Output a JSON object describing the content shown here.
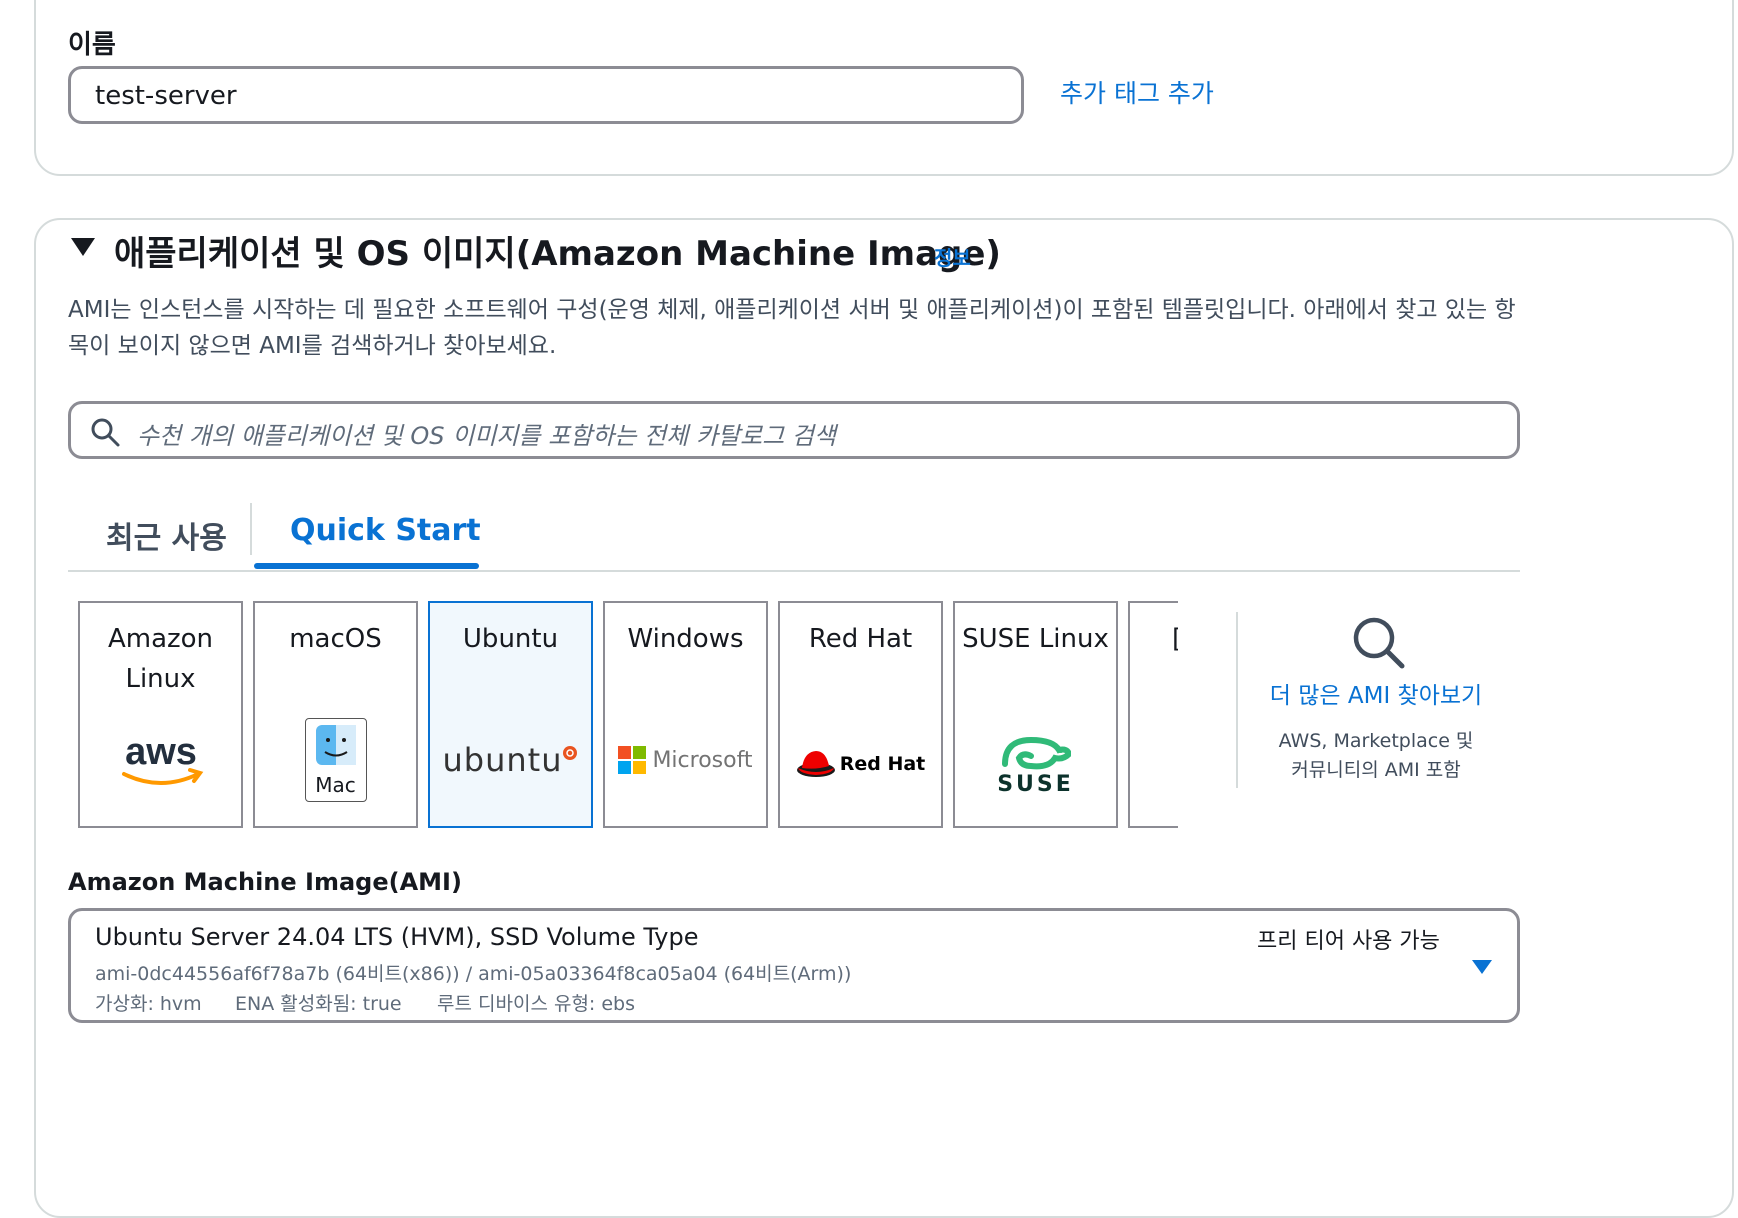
{
  "name_section": {
    "label": "이름",
    "value": "test-server",
    "add_tags_link": "추가 태그 추가"
  },
  "ami_section": {
    "title": "애플리케이션 및 OS 이미지(Amazon Machine Image)",
    "info_link": "정보",
    "description": "AMI는 인스턴스를 시작하는 데 필요한 소프트웨어 구성(운영 체제, 애플리케이션 서버 및 애플리케이션)이 포함된 템플릿입니다. 아래에서 찾고 있는 항목이 보이지 않으면 AMI를 검색하거나 찾아보세요.",
    "search_placeholder": "수천 개의 애플리케이션 및 OS 이미지를 포함하는 전체 카탈로그 검색",
    "tabs": [
      {
        "label": "최근 사용",
        "active": false
      },
      {
        "label": "Quick Start",
        "active": true
      }
    ],
    "os_cards": [
      {
        "name": "Amazon Linux",
        "logo": "aws-logo",
        "logo_text": "aws"
      },
      {
        "name": "macOS",
        "logo": "mac-finder-logo",
        "logo_text": "Mac"
      },
      {
        "name": "Ubuntu",
        "logo": "ubuntu-logo",
        "logo_text": "ubuntu",
        "selected": true
      },
      {
        "name": "Windows",
        "logo": "microsoft-logo",
        "logo_text": "Microsoft"
      },
      {
        "name": "Red Hat",
        "logo": "redhat-logo",
        "logo_text": "Red Hat"
      },
      {
        "name": "SUSE Linux",
        "logo": "suse-logo",
        "logo_text": "SUSE"
      },
      {
        "name": "[",
        "logo": "",
        "logo_text": ""
      }
    ],
    "browse_more": {
      "icon": "search-icon",
      "link": "더 많은 AMI 찾아보기",
      "desc_line1": "AWS, Marketplace 및",
      "desc_line2": "커뮤니티의 AMI 포함"
    },
    "ami_label": "Amazon Machine Image(AMI)",
    "ami_select": {
      "title": "Ubuntu Server 24.04 LTS (HVM), SSD Volume Type",
      "free_tier": "프리 티어 사용 가능",
      "ids": "ami-0dc44556af6f78a7b (64비트(x86)) / ami-05a03364f8ca05a04 (64비트(Arm))",
      "meta_virtualization": "가상화: hvm",
      "meta_ena": "ENA 활성화됨: true",
      "meta_root": "루트 디바이스 유형: ebs"
    }
  },
  "colors": {
    "link": "#0972d3",
    "border": "#8c8c94",
    "panel_border": "#d5dbdb",
    "selected_bg": "#f1f8fd"
  }
}
